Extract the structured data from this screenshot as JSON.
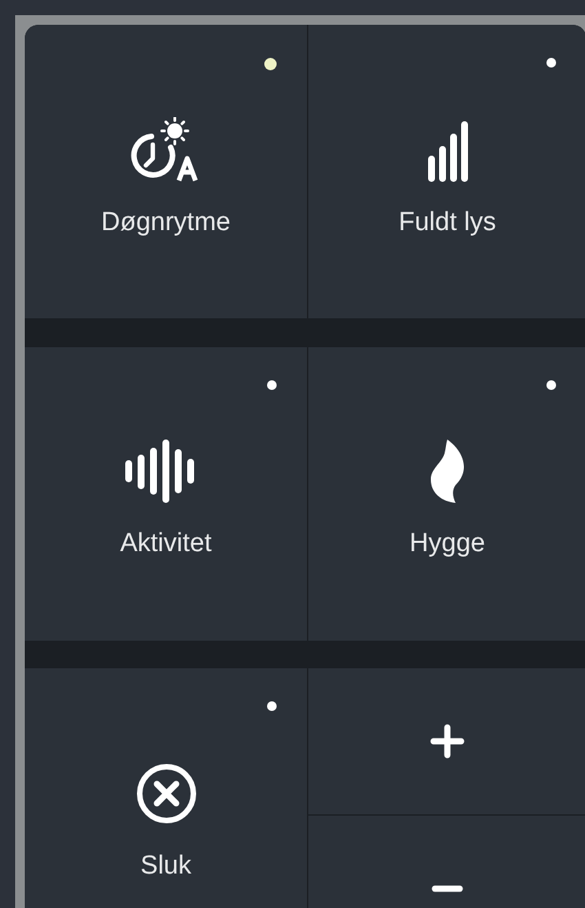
{
  "modes": [
    {
      "kind": "circadian",
      "label": "Døgnrytme",
      "active": true
    },
    {
      "kind": "full",
      "label": "Fuldt lys",
      "active": false
    },
    {
      "kind": "activity",
      "label": "Aktivitet",
      "active": false
    },
    {
      "kind": "cozy",
      "label": "Hygge",
      "active": false
    },
    {
      "kind": "off",
      "label": "Sluk",
      "active": false
    }
  ],
  "dimmer": [
    {
      "kind": "up"
    },
    {
      "kind": "down"
    }
  ]
}
